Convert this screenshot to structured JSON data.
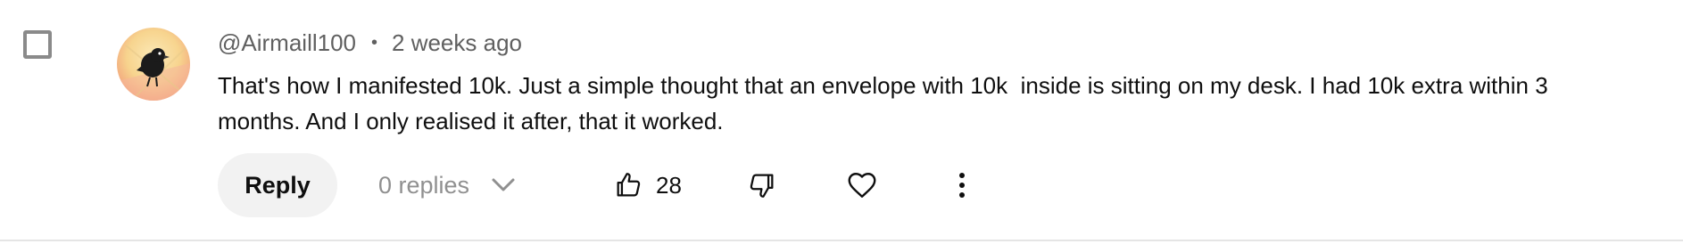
{
  "comment": {
    "author": "@Airmaill100",
    "separator": "•",
    "timestamp": "2 weeks ago",
    "text": "That's how I manifested 10k. Just a simple thought that an envelope with 10k  inside is sitting on my desk. I had 10k extra within 3 months. And I only realised it after, that it worked.",
    "avatar_icon": "avatar-bird-icon"
  },
  "actions": {
    "reply_label": "Reply",
    "replies_label": "0 replies",
    "like_count": "28",
    "icons": {
      "like": "thumbs-up-icon",
      "dislike": "thumbs-down-icon",
      "heart": "heart-icon",
      "more": "more-vertical-icon",
      "expand": "chevron-down-icon"
    }
  },
  "colors": {
    "text_primary": "#0f0f0f",
    "text_secondary": "#606060",
    "text_disabled": "#909090",
    "reply_bg": "#f2f2f2",
    "divider": "#e5e5e5",
    "checkbox_border": "#8a8a8a"
  }
}
